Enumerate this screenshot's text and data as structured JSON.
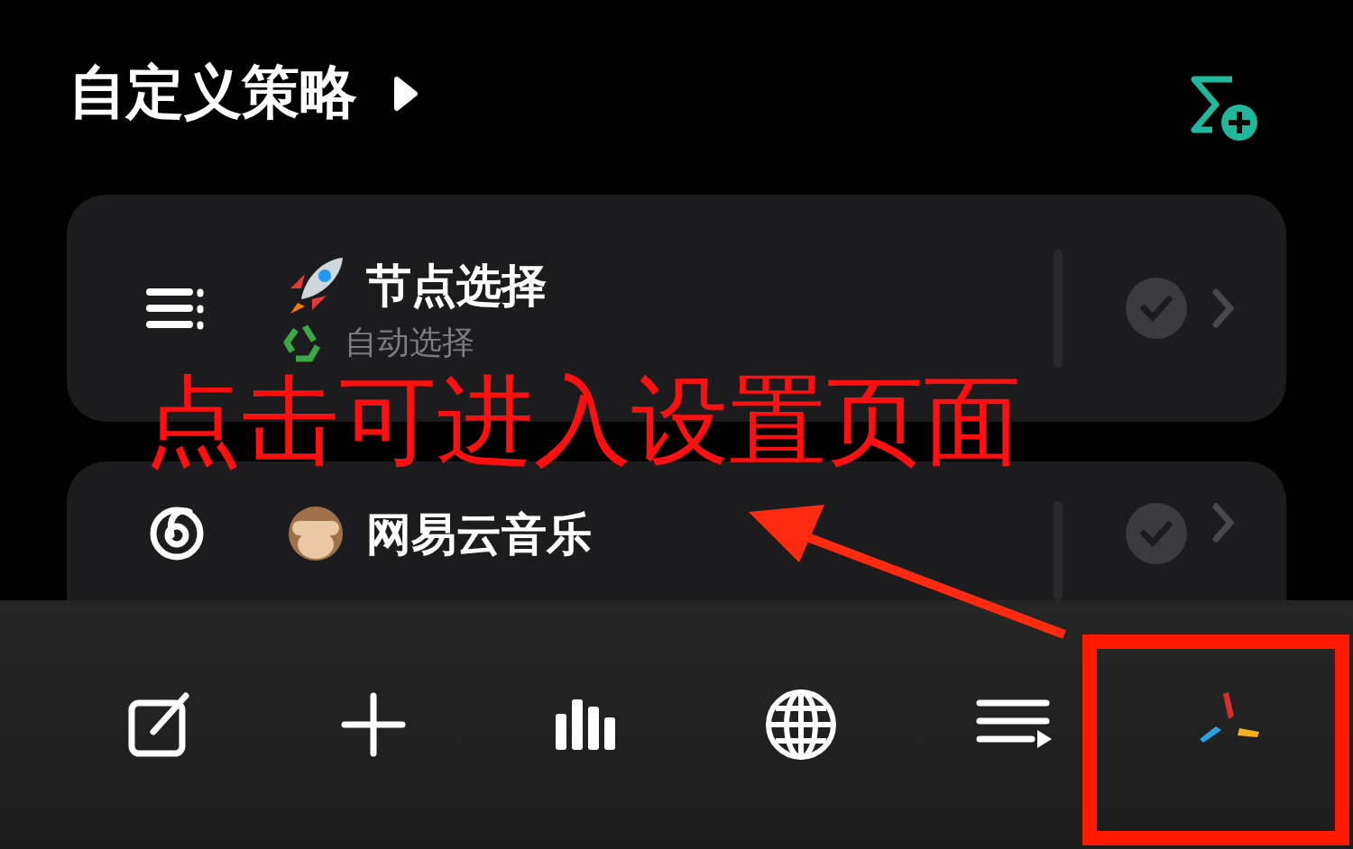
{
  "header": {
    "title": "自定义策略"
  },
  "policies": [
    {
      "name": "节点选择",
      "subtitle": "自动选择"
    },
    {
      "name": "网易云音乐"
    }
  ],
  "toolbar": [
    {
      "kind": "edit"
    },
    {
      "kind": "add"
    },
    {
      "kind": "stats"
    },
    {
      "kind": "globe"
    },
    {
      "kind": "queue"
    },
    {
      "kind": "logo"
    }
  ],
  "annotation": {
    "text": "点击可进入设置页面"
  }
}
